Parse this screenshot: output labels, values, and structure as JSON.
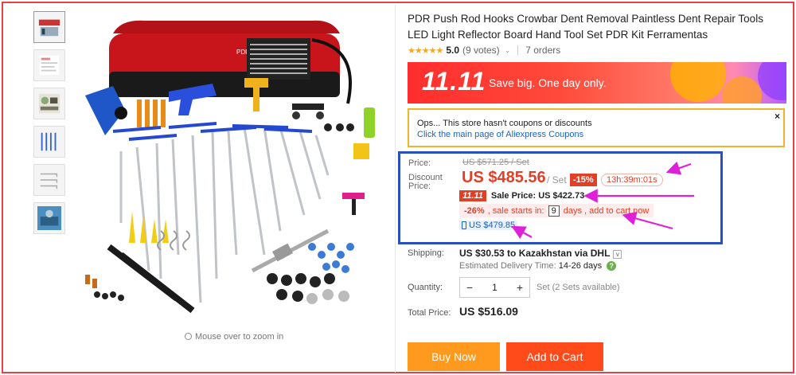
{
  "product": {
    "title": "PDR Push Rod Hooks Crowbar Dent Removal Paintless Dent Repair Tools LED Light Reflector Board Hand Tool Set PDR Kit Ferramentas",
    "rating_stars": "★★★★★",
    "rating_value": "5.0",
    "votes": "(9 votes)",
    "orders": "7 orders",
    "zoom_hint": "Mouse over to zoom in"
  },
  "banner": {
    "badge": "11.11",
    "slogan": "Save big. One day only."
  },
  "coupon": {
    "message": "Ops... This store hasn't coupons or discounts",
    "link": "Click the main page of Aliexpress Coupons",
    "close": "×"
  },
  "price": {
    "label": "Price:",
    "original": "US $571.25 / Set",
    "discount_label_1": "Discount",
    "discount_label_2": "Price:",
    "current": "US $485.56",
    "unit": "/ Set",
    "discount_pct": "-15%",
    "timer": "13h:39m:01s",
    "sale_tag": "11.11",
    "sale_price": "Sale Price: US $422.73",
    "sale_pct": "-26%",
    "sale_starts": ", sale starts in:",
    "sale_days": "9",
    "sale_suffix": "days , add to cart now",
    "mobile_price": "US $479.85"
  },
  "shipping": {
    "label": "Shipping:",
    "value": "US $30.53 to Kazakhstan via DHL",
    "dropdown": "v",
    "eta_label": "Estimated Delivery Time:",
    "eta_days": "14-26 days",
    "help": "?"
  },
  "quantity": {
    "label": "Quantity:",
    "minus": "−",
    "value": "1",
    "plus": "+",
    "available": "Set (2 Sets available)"
  },
  "total": {
    "label": "Total Price:",
    "value": "US $516.09"
  },
  "actions": {
    "buy_now": "Buy Now",
    "add_to_cart": "Add to Cart"
  },
  "colors": {
    "annotation_red": "#e5414a",
    "annotation_blue": "#2a4fbf",
    "annotation_arrow": "#e020d8",
    "price_red": "#e23f27",
    "buy_orange": "#ff9a1f",
    "cart_orange": "#ff4a1a"
  }
}
